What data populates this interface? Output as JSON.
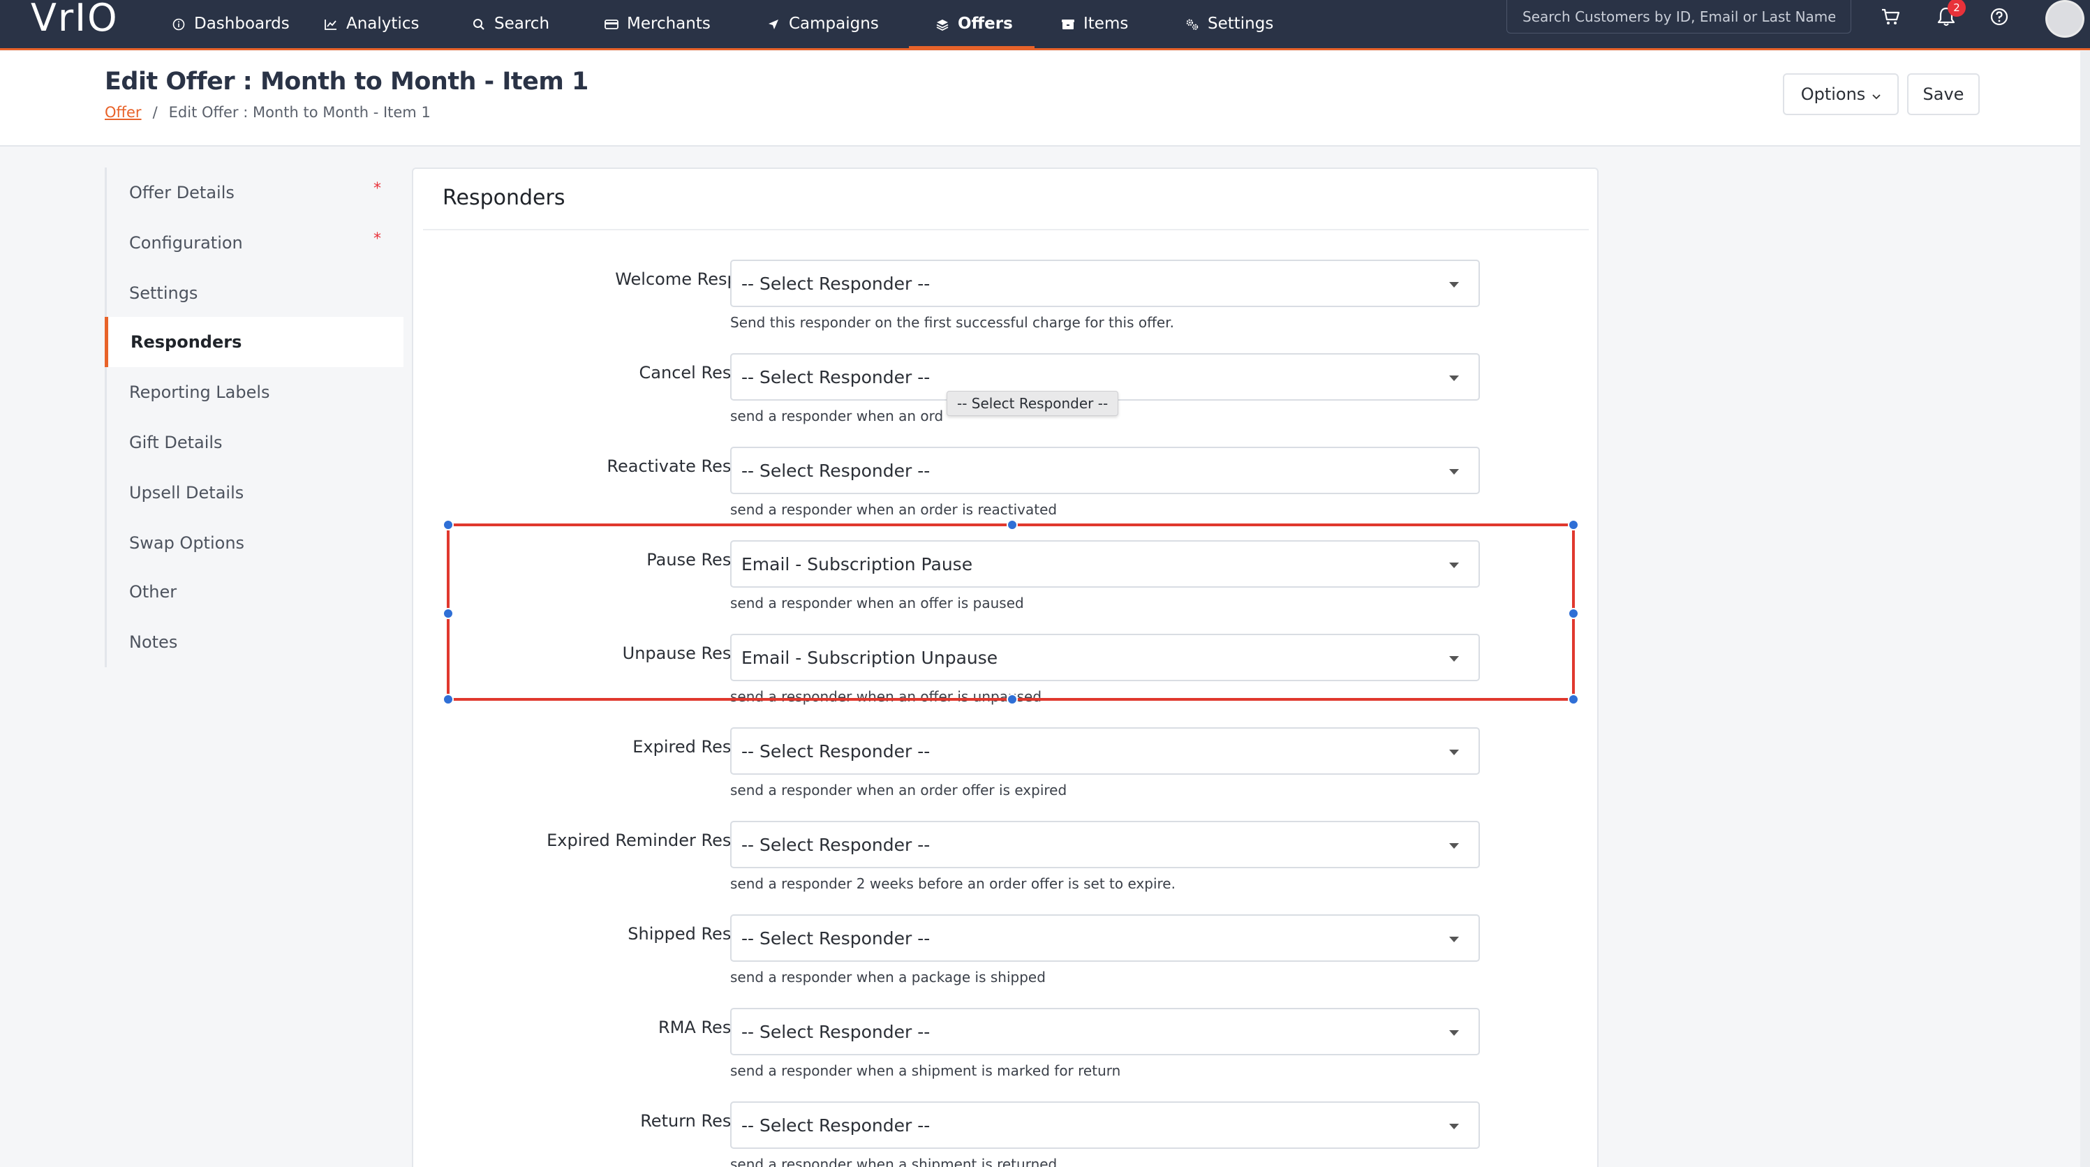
{
  "nav": {
    "logo": "VrIO",
    "items": [
      {
        "label": "Dashboards",
        "icon": "info-circle-icon"
      },
      {
        "label": "Analytics",
        "icon": "line-chart-icon"
      },
      {
        "label": "Search",
        "icon": "search-icon"
      },
      {
        "label": "Merchants",
        "icon": "card-icon"
      },
      {
        "label": "Campaigns",
        "icon": "paper-plane-icon"
      },
      {
        "label": "Offers",
        "icon": "layers-icon"
      },
      {
        "label": "Items",
        "icon": "box-icon"
      },
      {
        "label": "Settings",
        "icon": "gears-icon"
      }
    ],
    "active": "Offers",
    "search_placeholder": "Search Customers by ID, Email or Last Name",
    "notification_count": "2"
  },
  "header": {
    "title": "Edit Offer : Month to Month - Item 1",
    "breadcrumb": {
      "link": "Offer",
      "separator": "/",
      "current": "Edit Offer : Month to Month - Item 1"
    },
    "options_label": "Options",
    "save_label": "Save"
  },
  "sidebar": {
    "items": [
      {
        "label": "Offer Details",
        "required": "*"
      },
      {
        "label": "Configuration",
        "required": "*"
      },
      {
        "label": "Settings"
      },
      {
        "label": "Responders"
      },
      {
        "label": "Reporting Labels"
      },
      {
        "label": "Gift Details"
      },
      {
        "label": "Upsell Details"
      },
      {
        "label": "Swap Options"
      },
      {
        "label": "Other"
      },
      {
        "label": "Notes"
      }
    ],
    "active": "Responders"
  },
  "main": {
    "title": "Responders",
    "tooltip": "-- Select Responder --",
    "rows": [
      {
        "label": "Welcome Responder.:",
        "value": "-- Select Responder --",
        "help": "Send this responder on the first successful charge for this offer."
      },
      {
        "label": "Cancel Responder:",
        "value": "-- Select Responder --",
        "help": "send a responder when an ord"
      },
      {
        "label": "Reactivate Responder:",
        "value": "-- Select Responder --",
        "help": "send a responder when an order is reactivated"
      },
      {
        "label": "Pause Responder:",
        "value": "Email - Subscription Pause",
        "help": "send a responder when an offer is paused"
      },
      {
        "label": "Unpause Responder:",
        "value": "Email - Subscription Unpause",
        "help": "send a responder when an offer is unpaused"
      },
      {
        "label": "Expired Responder:",
        "value": "-- Select Responder --",
        "help": "send a responder when an order offer is expired"
      },
      {
        "label": "Expired Reminder Responder:",
        "value": "-- Select Responder --",
        "help": "send a responder 2 weeks before an order offer is set to expire."
      },
      {
        "label": "Shipped Responder:",
        "value": "-- Select Responder --",
        "help": "send a responder when a package is shipped"
      },
      {
        "label": "RMA Responder:",
        "value": "-- Select Responder --",
        "help": "send a responder when a shipment is marked for return"
      },
      {
        "label": "Return Responder:",
        "value": "-- Select Responder --",
        "help": "send a responder when a shipment is returned"
      }
    ]
  },
  "colors": {
    "nav_bg": "#2a3346",
    "accent": "#e8632a",
    "highlight": "#e0382e",
    "handle": "#2f6fd6"
  }
}
